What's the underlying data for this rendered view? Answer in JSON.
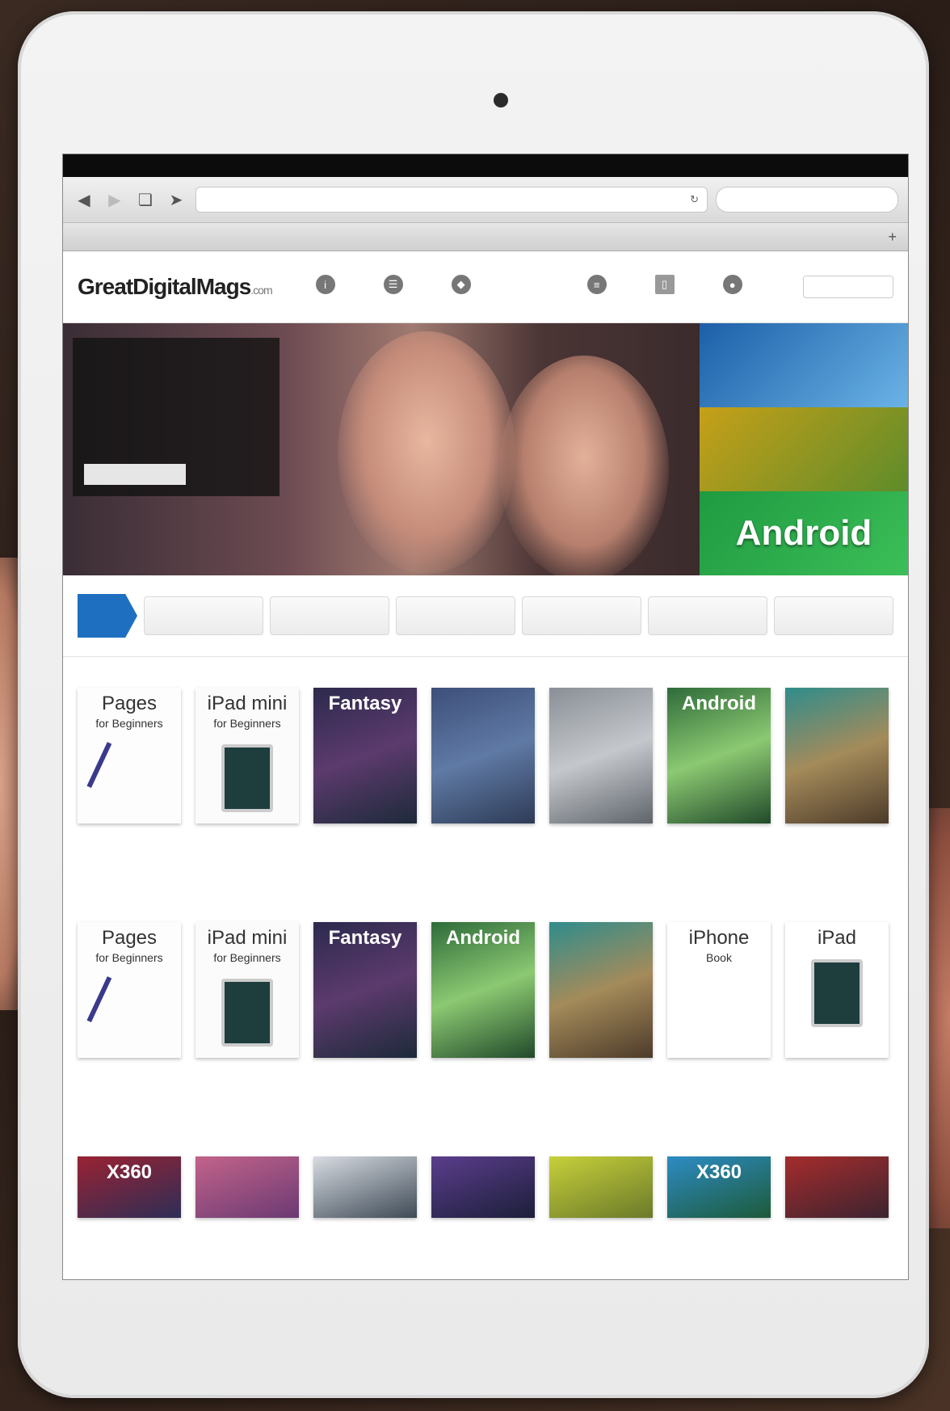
{
  "browser": {
    "url": "",
    "search_placeholder": "",
    "page_title": "",
    "add_tab": "+"
  },
  "status": {
    "left": "",
    "center": "",
    "right": ""
  },
  "site": {
    "logo_main": "GreatDigitalMags",
    "logo_suffix": ".com",
    "nav": [
      {
        "label": "",
        "icon": "info-icon"
      },
      {
        "label": "",
        "icon": "news-icon"
      },
      {
        "label": "",
        "icon": "tag-icon"
      },
      {
        "label": "",
        "icon": "magazine-icon"
      },
      {
        "label": "",
        "icon": "list-icon"
      },
      {
        "label": "",
        "icon": "book-icon"
      },
      {
        "label": "",
        "icon": "chat-icon"
      }
    ]
  },
  "hero": {
    "panel_title": "",
    "panel_text": "",
    "cta": "",
    "side_tiles": [
      "",
      "",
      "Android"
    ]
  },
  "categories": [
    "",
    "",
    "",
    "",
    "",
    "",
    ""
  ],
  "shelves": [
    {
      "title": "",
      "items": [
        {
          "cover": "Pages",
          "sub": "for Beginners",
          "style": "c-pages",
          "dark": true,
          "art": "pen"
        },
        {
          "cover": "iPad mini",
          "sub": "for Beginners",
          "style": "c-ipadmini",
          "dark": true,
          "art": "tablet"
        },
        {
          "cover": "Fantasy",
          "sub": "",
          "style": "c-fantasy",
          "dark": false,
          "art": ""
        },
        {
          "cover": "",
          "sub": "",
          "style": "c-blue",
          "dark": false,
          "art": ""
        },
        {
          "cover": "",
          "sub": "",
          "style": "c-grey",
          "dark": false,
          "art": ""
        },
        {
          "cover": "Android",
          "sub": "",
          "style": "c-android",
          "dark": false,
          "art": ""
        },
        {
          "cover": "",
          "sub": "",
          "style": "c-teal",
          "dark": false,
          "art": ""
        }
      ]
    },
    {
      "title": "",
      "items": [
        {
          "cover": "Pages",
          "sub": "for Beginners",
          "style": "c-pages",
          "dark": true,
          "art": "pen"
        },
        {
          "cover": "iPad mini",
          "sub": "for Beginners",
          "style": "c-ipadmini",
          "dark": true,
          "art": "tablet"
        },
        {
          "cover": "Fantasy",
          "sub": "",
          "style": "c-fantasy",
          "dark": false,
          "art": ""
        },
        {
          "cover": "Android",
          "sub": "",
          "style": "c-android",
          "dark": false,
          "art": ""
        },
        {
          "cover": "",
          "sub": "",
          "style": "c-teal",
          "dark": false,
          "art": ""
        },
        {
          "cover": "iPhone",
          "sub": "Book",
          "style": "c-iphone",
          "dark": true,
          "art": ""
        },
        {
          "cover": "iPad",
          "sub": "",
          "style": "c-ipad",
          "dark": true,
          "art": "tablet"
        }
      ]
    },
    {
      "title": "",
      "items": [
        {
          "cover": "X360",
          "sub": "",
          "style": "c-x360",
          "dark": false,
          "art": ""
        },
        {
          "cover": "",
          "sub": "",
          "style": "c-pink",
          "dark": false,
          "art": ""
        },
        {
          "cover": "",
          "sub": "",
          "style": "c-light",
          "dark": false,
          "art": ""
        },
        {
          "cover": "",
          "sub": "",
          "style": "c-purple",
          "dark": false,
          "art": ""
        },
        {
          "cover": "",
          "sub": "",
          "style": "c-yellow",
          "dark": false,
          "art": ""
        },
        {
          "cover": "X360",
          "sub": "",
          "style": "c-x360b",
          "dark": false,
          "art": ""
        },
        {
          "cover": "",
          "sub": "",
          "style": "c-red",
          "dark": false,
          "art": ""
        }
      ]
    }
  ],
  "colors": {
    "accent": "#1f6fc1",
    "status_bar": "#0c0c0c"
  }
}
